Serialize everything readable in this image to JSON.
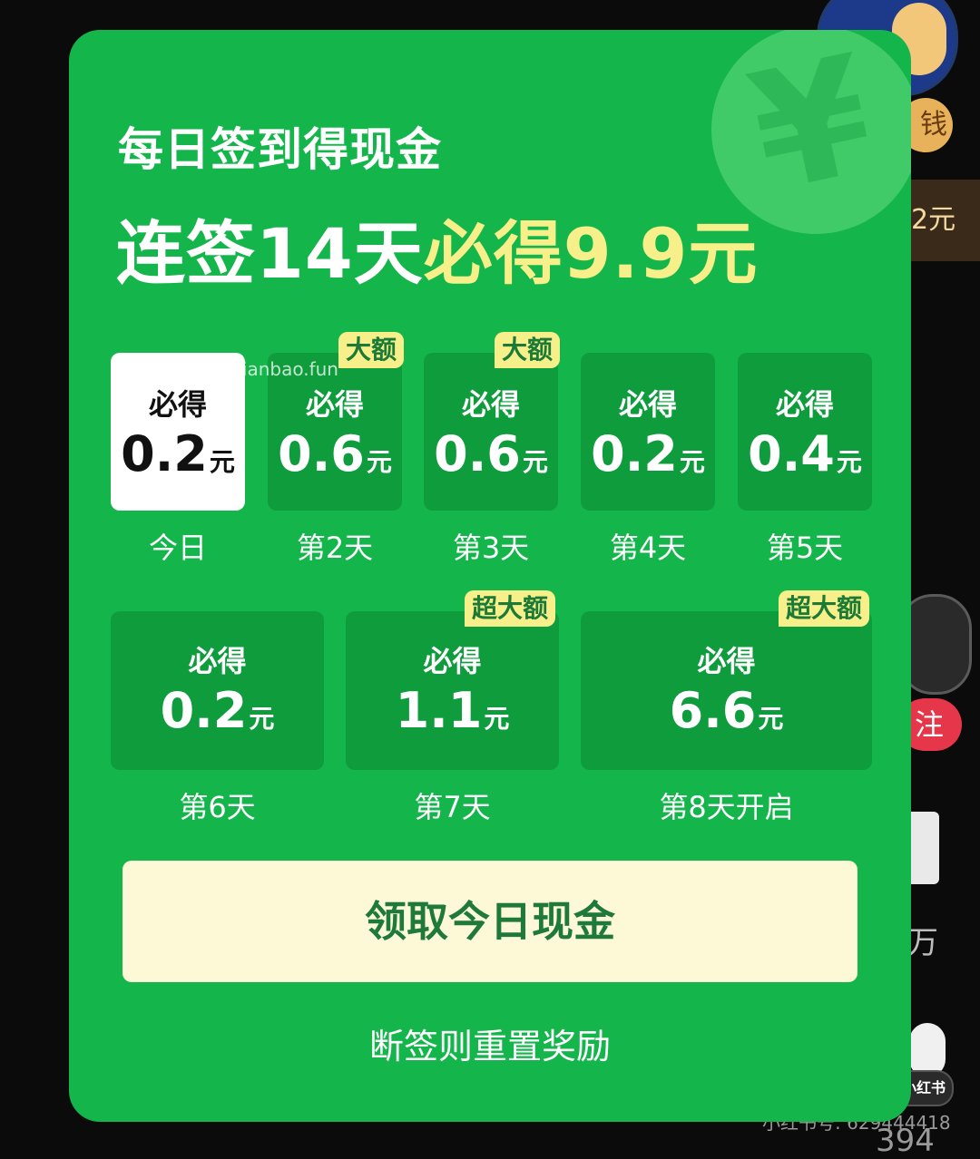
{
  "background": {
    "money_pill": "钱",
    "strip_text": "2元",
    "follow_text": "注",
    "wan_text": "万",
    "xhs_logo": "小红书",
    "xhs_id": "小红书号: 629444418",
    "count": "394"
  },
  "card": {
    "title": "每日签到得现金",
    "headline_white": "连签14天",
    "headline_yellow": "必得9.9元",
    "yen_glyph": "¥",
    "watermark": "线报酷-new.xianbao.fun",
    "unit": "元",
    "must_label": "必得",
    "days": [
      {
        "amount": "0.2",
        "label": "今日",
        "badge": ""
      },
      {
        "amount": "0.6",
        "label": "第2天",
        "badge": "大额"
      },
      {
        "amount": "0.6",
        "label": "第3天",
        "badge": "大额"
      },
      {
        "amount": "0.2",
        "label": "第4天",
        "badge": ""
      },
      {
        "amount": "0.4",
        "label": "第5天",
        "badge": ""
      },
      {
        "amount": "0.2",
        "label": "第6天",
        "badge": ""
      },
      {
        "amount": "1.1",
        "label": "第7天",
        "badge": "超大额"
      },
      {
        "amount": "6.6",
        "label": "第8天开启",
        "badge": "超大额"
      }
    ],
    "claim_button": "领取今日现金",
    "reset_note": "断签则重置奖励"
  },
  "colors": {
    "card_green": "#14b54b",
    "tile_green": "#0f9c3d",
    "highlight_yellow": "#f7f08a",
    "button_cream": "#fdf9d6"
  }
}
